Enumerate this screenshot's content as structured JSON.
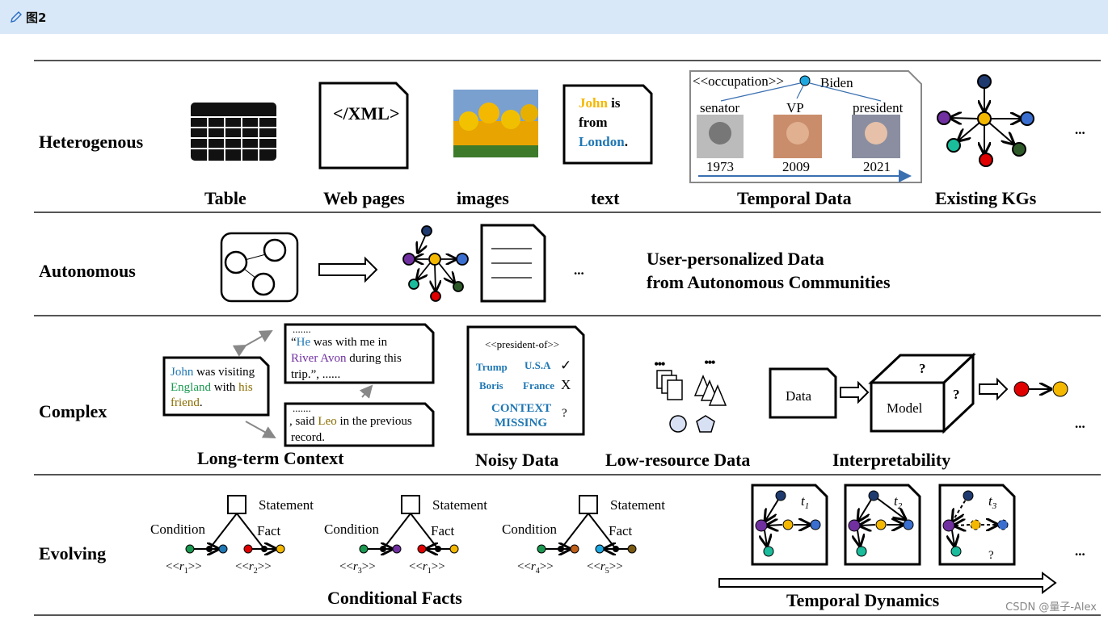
{
  "header": {
    "title": "图2",
    "icon": "pencil-icon"
  },
  "rows": {
    "heterogenous": {
      "label": "Heterogenous",
      "captions": [
        "Table",
        "Web pages",
        "images",
        "text",
        "Temporal Data",
        "Existing KGs"
      ],
      "xml": "</XML>",
      "text_card": {
        "w1": "John",
        "w2": "is",
        "w3": "from",
        "w4": "London",
        "w5": "."
      },
      "temporal": {
        "relation": "<<occupation>>",
        "entity": "Biden",
        "roles": [
          "senator",
          "VP",
          "president"
        ],
        "years": [
          "1973",
          "2009",
          "2021"
        ]
      },
      "ellipsis": "..."
    },
    "autonomous": {
      "label": "Autonomous",
      "ellipsis": "...",
      "description_line1": "User-personalized Data",
      "description_line2": "from Autonomous Communities"
    },
    "complex": {
      "label": "Complex",
      "captions": [
        "Long-term  Context",
        "Noisy Data",
        "Low-resource Data",
        "Interpretability"
      ],
      "card1": {
        "a": "John",
        "b": " was visiting",
        "c": "England",
        "d": " with ",
        "e": "his",
        "f": "friend",
        "g": "."
      },
      "card2": {
        "dots": ".......",
        "a": "“",
        "b": "He",
        "c": " was with me in",
        "d": "River Avon",
        "e": " during this",
        "f": "trip.”, ......"
      },
      "card3": {
        "dots": ".......",
        "a": ", said ",
        "b": "Leo",
        "c": " in the previous",
        "d": "record."
      },
      "noisy": {
        "relation": "<<president-of>>",
        "s1": "Trump",
        "o1": "U.S.A",
        "m1": "✓",
        "s2": "Boris",
        "o2": "France",
        "m2": "X",
        "c1": "CONTEXT",
        "c2": "MISSING",
        "m3": "?"
      },
      "lowres_dots": [
        "...",
        "..."
      ],
      "interp": {
        "data": "Data",
        "model": "Model",
        "q1": "?",
        "q2": "?"
      },
      "ellipsis": "..."
    },
    "evolving": {
      "label": "Evolving",
      "captions": [
        "Conditional Facts",
        "Temporal Dynamics"
      ],
      "facts": [
        {
          "statement": "Statement",
          "condition": "Condition",
          "fact": "Fact",
          "r_left": "1",
          "r_right": "2"
        },
        {
          "statement": "Statement",
          "condition": "Condition",
          "fact": "Fact",
          "r_left": "3",
          "r_right": "1"
        },
        {
          "statement": "Statement",
          "condition": "Condition",
          "fact": "Fact",
          "r_left": "4",
          "r_right": "5"
        }
      ],
      "times": [
        "1",
        "2",
        "3"
      ],
      "unknown": "?",
      "ellipsis": "..."
    }
  },
  "colors": {
    "header_bg": "#d9e8f8",
    "yellow": "#f5b800",
    "blue": "#1f77b4",
    "green": "#1a9850",
    "purple": "#7030a0",
    "olive": "#8a6d00",
    "red": "#e00000"
  },
  "watermark": "CSDN @量子-Alex"
}
